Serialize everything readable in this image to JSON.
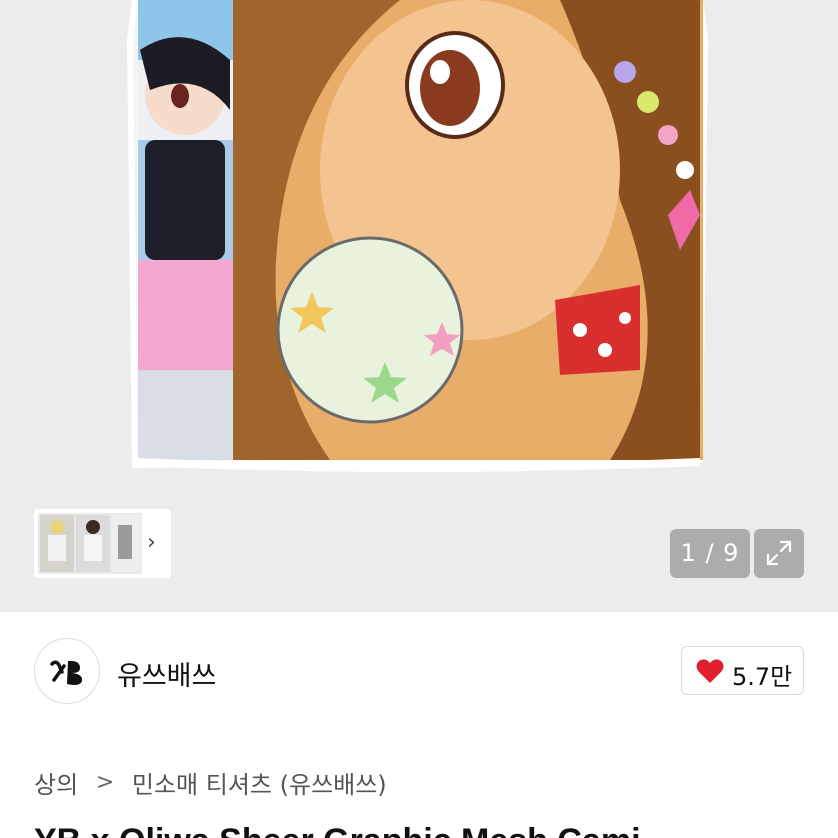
{
  "gallery": {
    "counter_text": "1 / 9",
    "current": 1,
    "total": 9,
    "thumbnail_alt": "product-thumbnails",
    "next_icon": "chevron-right-icon",
    "expand_icon": "expand-icon"
  },
  "seller": {
    "name": "유쓰배쓰",
    "avatar_icon": "brand-logo-icon"
  },
  "likes": {
    "icon": "heart-icon",
    "count": "5.7만",
    "color": "#e0202e"
  },
  "breadcrumb": {
    "items": [
      "상의",
      "민소매 티셔츠 (유쓰배쓰)"
    ],
    "separator": ">"
  },
  "product": {
    "title": "YB x Oliwa Sheer Graphic Mesh Cami"
  }
}
